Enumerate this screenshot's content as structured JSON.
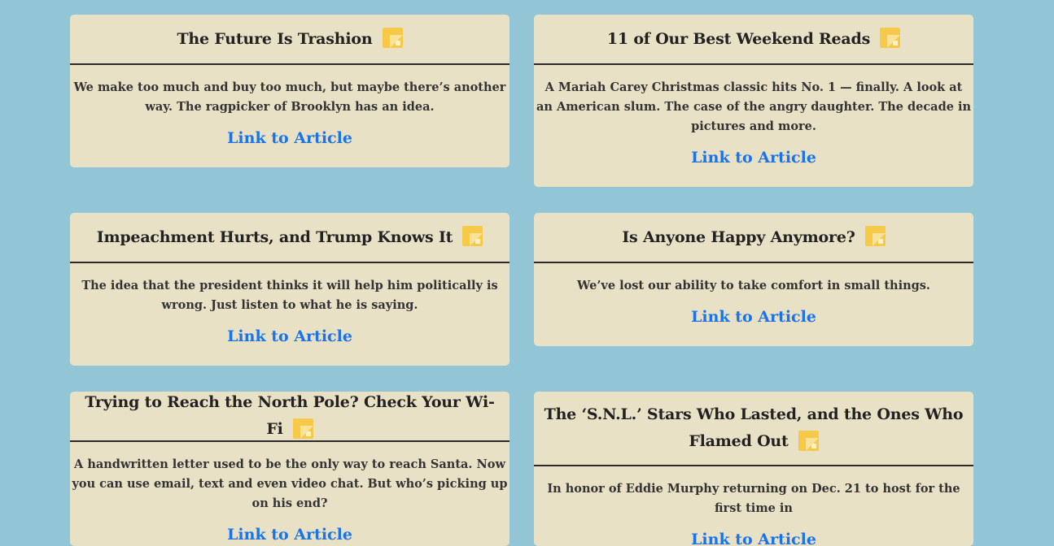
{
  "articles": [
    {
      "title": "The Future Is Trashion",
      "description": "We make too much and buy too much, but maybe there’s another way. The ragpicker of Brooklyn has an idea.",
      "link_label": "Link to Article"
    },
    {
      "title": "11 of Our Best Weekend Reads",
      "description": "A Mariah Carey Christmas classic hits No. 1 — finally. A look at an American slum. The case of the angry daughter. The decade in pictures and more.",
      "link_label": "Link to Article"
    },
    {
      "title": "Impeachment Hurts, and Trump Knows It",
      "description": "The idea that the president thinks it will help him politically is wrong. Just listen to what he is saying.",
      "link_label": "Link to Article"
    },
    {
      "title": "Is Anyone Happy Anymore?",
      "description": "We’ve lost our ability to take comfort in small things.",
      "link_label": "Link to Article"
    },
    {
      "title": "Trying to Reach the North Pole? Check Your Wi-Fi",
      "description": "A handwritten letter used to be the only way to reach Santa. Now you can use email, text and even video chat. But who’s picking up on his end?",
      "link_label": "Link to Article"
    },
    {
      "title": "The ‘S.N.L.’ Stars Who Lasted, and the Ones Who Flamed Out",
      "description": "In honor of Eddie Murphy returning on Dec. 21 to host for the first time in",
      "link_label": "Link to Article"
    }
  ]
}
